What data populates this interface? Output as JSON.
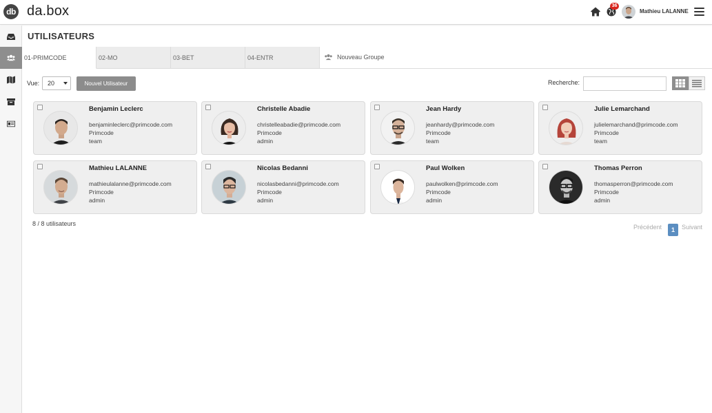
{
  "app": {
    "logo_mark": "db",
    "logo_text": "da.box",
    "notification_count": "36",
    "user_name": "Mathieu LALANNE"
  },
  "icons": {
    "home": "home-icon",
    "notifications": "globe-icon",
    "menu": "hamburger-icon",
    "sidebar": [
      "inbox-icon",
      "users-icon",
      "map-icon",
      "archive-icon",
      "id-card-icon"
    ]
  },
  "colors": {
    "accent": "#5b8ec1",
    "sidebar_active": "#8e8e8e",
    "badge": "#d9251d",
    "card_bg": "#efefef"
  },
  "page": {
    "title": "UTILISATEURS"
  },
  "tabs": [
    {
      "label": "01-PRIMCODE",
      "active": true
    },
    {
      "label": "02-MO",
      "active": false
    },
    {
      "label": "03-BET",
      "active": false
    },
    {
      "label": "04-ENTR",
      "active": false
    }
  ],
  "new_group_label": "Nouveau Groupe",
  "toolbar": {
    "view_label": "Vue:",
    "view_value": "20",
    "new_user_label": "Nouvel Utilisateur",
    "search_label": "Recherche:",
    "search_value": ""
  },
  "users": [
    {
      "name": "Benjamin Leclerc",
      "email": "benjaminleclerc@primcode.com",
      "company": "Primcode",
      "role": "team"
    },
    {
      "name": "Christelle Abadie",
      "email": "christelleabadie@primcode.com",
      "company": "Primcode",
      "role": "admin"
    },
    {
      "name": "Jean Hardy",
      "email": "jeanhardy@primcode.com",
      "company": "Primcode",
      "role": "team"
    },
    {
      "name": "Julie Lemarchand",
      "email": "julielemarchand@primcode.com",
      "company": "Primcode",
      "role": "team"
    },
    {
      "name": "Mathieu LALANNE",
      "email": "mathieulalanne@primcode.com",
      "company": "Primcode",
      "role": "admin"
    },
    {
      "name": "Nicolas Bedanni",
      "email": "nicolasbedanni@primcode.com",
      "company": "Primcode",
      "role": "admin"
    },
    {
      "name": "Paul Wolken",
      "email": "paulwolken@primcode.com",
      "company": "Primcode",
      "role": "admin"
    },
    {
      "name": "Thomas Perron",
      "email": "thomasperron@primcode.com",
      "company": "Primcode",
      "role": "admin"
    }
  ],
  "footer": {
    "count": "8 / 8 utilisateurs",
    "prev": "Précédent",
    "page": "1",
    "next": "Suivant"
  }
}
